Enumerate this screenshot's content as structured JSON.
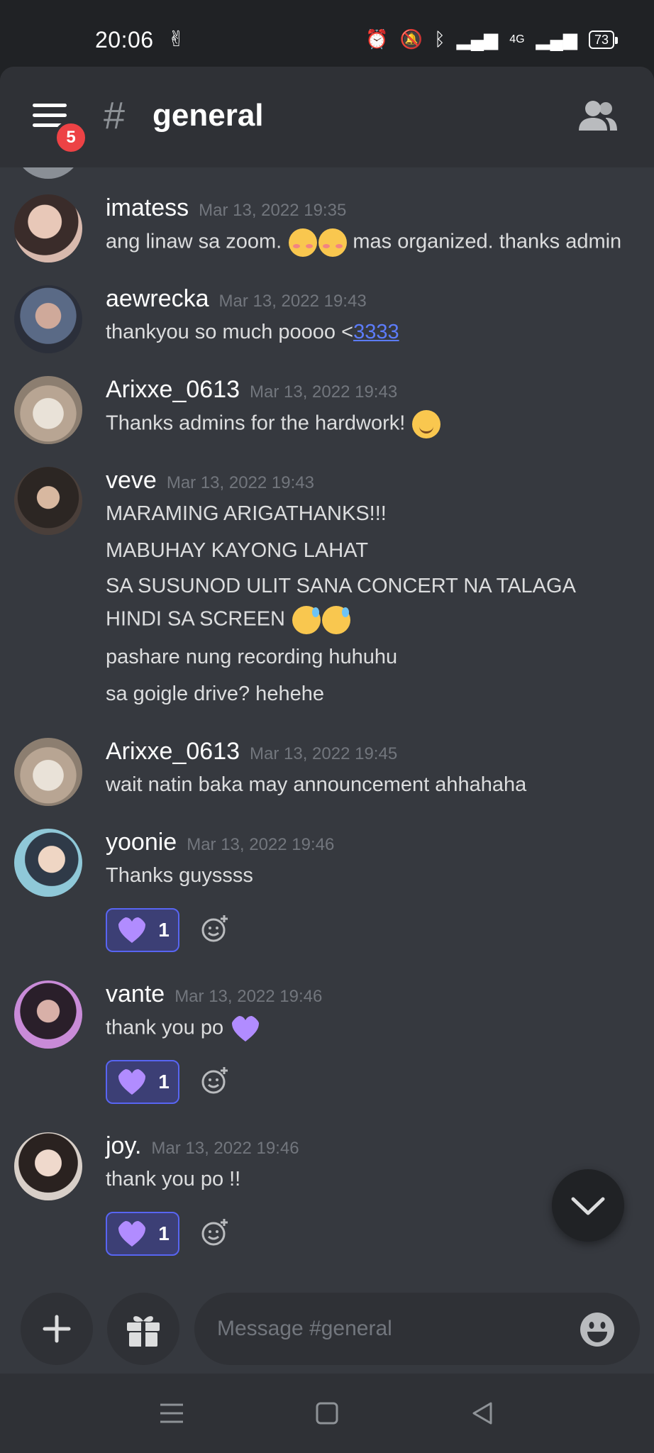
{
  "statusbar": {
    "time": "20:06",
    "network": "4G",
    "battery": "73",
    "icons": [
      "alarm-icon",
      "mute-icon",
      "bluetooth-icon",
      "signal-icon",
      "signal-4g-icon"
    ]
  },
  "header": {
    "badge_count": "5",
    "hash": "#",
    "channel": "general"
  },
  "messages": [
    {
      "author": "imatess",
      "timestamp": "Mar 13, 2022 19:35",
      "lines": [
        {
          "pre": "ang linaw sa zoom. ",
          "post": " mas organized. thanks admin"
        }
      ]
    },
    {
      "author": "aewrecka",
      "timestamp": "Mar 13, 2022 19:43",
      "lines": [
        {
          "pre": "thankyou so much poooo <",
          "link": "3333"
        }
      ]
    },
    {
      "author": "Arixxe_0613",
      "timestamp": "Mar 13, 2022 19:43",
      "lines": [
        {
          "pre": "Thanks admins for the hardwork! "
        }
      ]
    },
    {
      "author": "veve",
      "timestamp": "Mar 13, 2022 19:43",
      "lines": [
        {
          "text": "MARAMING ARIGATHANKS!!!"
        },
        {
          "text": "MABUHAY KAYONG LAHAT"
        },
        {
          "text": "SA SUSUNOD ULIT SANA CONCERT NA TALAGA"
        },
        {
          "text": "HINDI SA SCREEN "
        },
        {
          "text": "pashare nung recording huhuhu"
        },
        {
          "text": "sa goigle drive? hehehe"
        }
      ]
    },
    {
      "author": "Arixxe_0613",
      "timestamp": "Mar 13, 2022 19:45",
      "lines": [
        {
          "text": "wait natin baka may announcement ahhahaha"
        }
      ]
    },
    {
      "author": "yoonie",
      "timestamp": "Mar 13, 2022 19:46",
      "lines": [
        {
          "text": "Thanks guyssss"
        }
      ],
      "reaction": {
        "emoji": "purple-heart",
        "count": "1"
      }
    },
    {
      "author": "vante",
      "timestamp": "Mar 13, 2022 19:46",
      "lines": [
        {
          "text": "thank you po "
        }
      ],
      "reaction": {
        "emoji": "purple-heart",
        "count": "1"
      }
    },
    {
      "author": "joy.",
      "timestamp": "Mar 13, 2022 19:46",
      "lines": [
        {
          "text": "thank you po !!"
        }
      ],
      "reaction": {
        "emoji": "purple-heart",
        "count": "1"
      }
    }
  ],
  "composer": {
    "placeholder": "Message #general"
  },
  "colors": {
    "background": "#36393f",
    "header": "#2f3136",
    "accent": "#5865f2",
    "badge": "#ed4245",
    "link": "#5c7cfa",
    "heart": "#b18cff"
  }
}
